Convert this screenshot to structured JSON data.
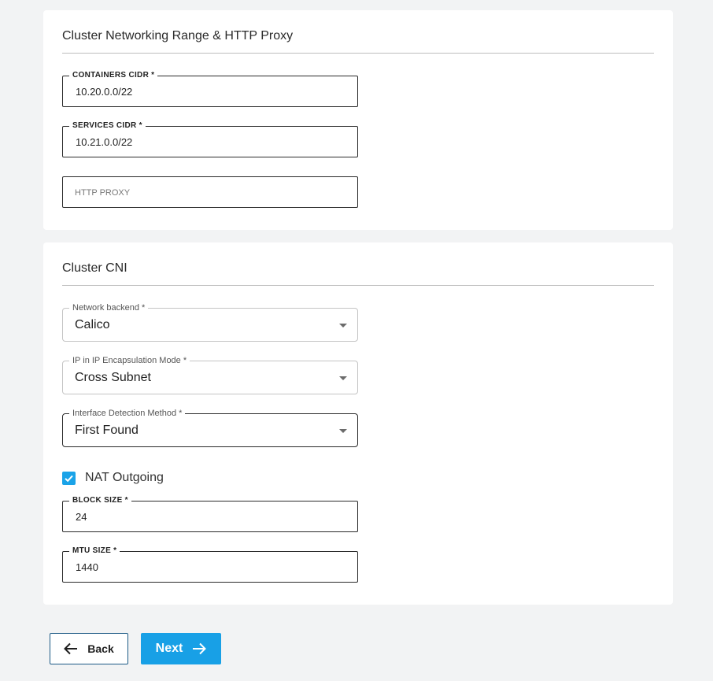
{
  "networking_card": {
    "title": "Cluster Networking Range & HTTP Proxy",
    "containers_cidr": {
      "label": "CONTAINERS CIDR *",
      "value": "10.20.0.0/22"
    },
    "services_cidr": {
      "label": "SERVICES CIDR *",
      "value": "10.21.0.0/22"
    },
    "http_proxy": {
      "placeholder": "HTTP PROXY",
      "value": ""
    }
  },
  "cni_card": {
    "title": "Cluster CNI",
    "network_backend": {
      "label": "Network backend *",
      "value": "Calico"
    },
    "encapsulation_mode": {
      "label": "IP in IP Encapsulation Mode *",
      "value": "Cross Subnet"
    },
    "interface_detection": {
      "label": "Interface Detection Method *",
      "value": "First Found"
    },
    "nat_outgoing": {
      "label": "NAT Outgoing",
      "checked": true
    },
    "block_size": {
      "label": "BLOCK SIZE *",
      "value": "24"
    },
    "mtu_size": {
      "label": "MTU SIZE *",
      "value": "1440"
    }
  },
  "footer": {
    "back_label": "Back",
    "next_label": "Next"
  },
  "colors": {
    "accent": "#18a0e6",
    "back_border": "#1d5b86",
    "background": "#f2f3f4"
  },
  "icons": {
    "back": "arrow-left-icon",
    "next": "arrow-right-icon",
    "dropdown": "caret-down-icon",
    "check": "check-icon"
  }
}
